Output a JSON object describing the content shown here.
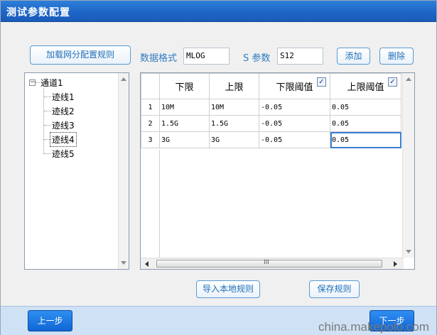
{
  "window": {
    "title": "测试参数配置"
  },
  "toolbar": {
    "load_rules_label": "加载网分配置规则",
    "data_format_label": "数据格式",
    "data_format_value": "MLOG",
    "s_param_label": "S 参数",
    "s_param_value": "S12",
    "add_label": "添加",
    "delete_label": "删除"
  },
  "tree": {
    "root": "通道1",
    "children": [
      "迹线1",
      "迹线2",
      "迹线3",
      "迹线4",
      "迹线5"
    ],
    "selected_index": 3
  },
  "grid": {
    "columns": [
      "下限",
      "上限",
      "下限阈值",
      "上限阈值"
    ],
    "checkboxes": {
      "lower_threshold": true,
      "upper_threshold": true
    },
    "rows": [
      {
        "num": "1",
        "lower": "10M",
        "upper": "10M",
        "lower_thr": "-0.05",
        "upper_thr": "0.05"
      },
      {
        "num": "2",
        "lower": "1.5G",
        "upper": "1.5G",
        "lower_thr": "-0.05",
        "upper_thr": "0.05"
      },
      {
        "num": "3",
        "lower": "3G",
        "upper": "3G",
        "lower_thr": "-0.05",
        "upper_thr": "0.05"
      }
    ],
    "scroll_grip": "III"
  },
  "actions": {
    "import_label": "导入本地规则",
    "save_label": "保存规则"
  },
  "nav": {
    "prev_label": "上一步",
    "next_label": "下一步"
  },
  "watermark": "china.makepolo.com",
  "colors": {
    "titlebar": "#1c64c6",
    "accent": "#2f7bc2",
    "nav_button": "#1a7ae0"
  }
}
